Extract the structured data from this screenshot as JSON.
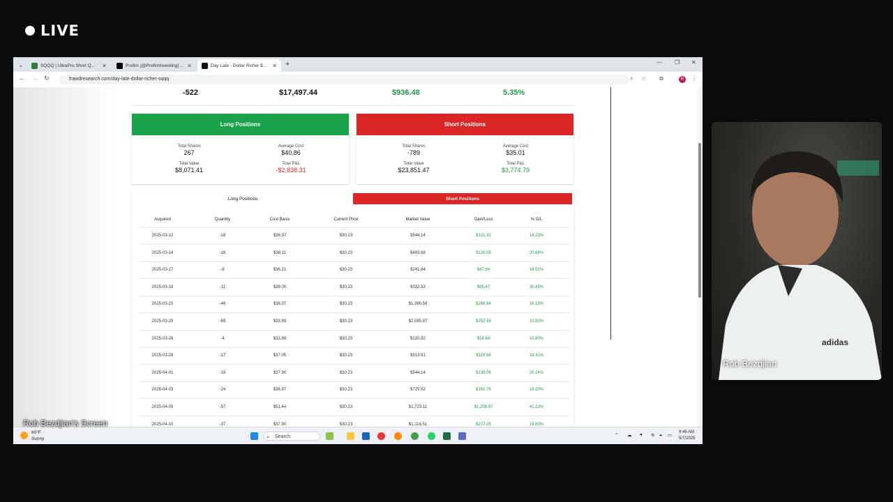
{
  "stream": {
    "live_label": "LIVE",
    "overlay_label": "Rob Bezdjian's Screen"
  },
  "browser": {
    "tabs": [
      {
        "title": "SQQQ | UltraPro Short QQQ | ProShares",
        "active": false
      },
      {
        "title": "Profim (@ProfimInvesting) / X",
        "active": false
      },
      {
        "title": "Day Late - Dollar Richer $SQQQ",
        "active": true
      }
    ],
    "url": "frawdresearch.com/day-late-dollar-richer-sqqq",
    "profile_initial": "R"
  },
  "summary": {
    "quantity": "-522",
    "cost": "$17,497.44",
    "pnl": "$936.48",
    "pct": "5.35%"
  },
  "long_card": {
    "title": "Long Positions",
    "shares_label": "Total Shares",
    "shares": "267",
    "avg_label": "Average Cost",
    "avg": "$40.86",
    "value_label": "Total Value",
    "value": "$8,071.41",
    "pnl_label": "Total P&L",
    "pnl": "-$2,838.31"
  },
  "short_card": {
    "title": "Short Positions",
    "shares_label": "Total Shares",
    "shares": "-789",
    "avg_label": "Average Cost",
    "avg": "$35.01",
    "value_label": "Total Value",
    "value": "$23,851.47",
    "pnl_label": "Total P&L",
    "pnl": "$3,774.79"
  },
  "table": {
    "tabs": [
      "Long Positions",
      "Short Positions"
    ],
    "active_tab": "Short Positions",
    "headers": [
      "Acquired",
      "Quantity",
      "Cost Basis",
      "Current Price",
      "Market Value",
      "Gain/Loss",
      "% G/L"
    ],
    "rows": [
      [
        "2025-03-12",
        "-18",
        "$36.97",
        "$30.23",
        "$544.14",
        "$121.32",
        "18.23%"
      ],
      [
        "2025-03-14",
        "-16",
        "$38.11",
        "$30.23",
        "$483.68",
        "$126.08",
        "20.68%"
      ],
      [
        "2025-03-17",
        "-8",
        "$36.21",
        "$30.23",
        "$241.84",
        "$47.84",
        "16.51%"
      ],
      [
        "2025-03-18",
        "-11",
        "$38.00",
        "$30.23",
        "$332.53",
        "$85.47",
        "20.45%"
      ],
      [
        "2025-03-20",
        "-46",
        "$36.07",
        "$30.23",
        "$1,390.58",
        "$268.64",
        "16.19%"
      ],
      [
        "2025-03-25",
        "-69",
        "$33.89",
        "$30.23",
        "$2,085.87",
        "$252.54",
        "10.80%"
      ],
      [
        "2025-03-26",
        "-4",
        "$33.89",
        "$30.23",
        "$120.92",
        "$14.64",
        "10.80%"
      ],
      [
        "2025-03-28",
        "-17",
        "$37.05",
        "$30.23",
        "$513.91",
        "$115.94",
        "18.41%"
      ],
      [
        "2025-04-01",
        "-18",
        "$37.90",
        "$30.23",
        "$544.14",
        "$138.06",
        "20.24%"
      ],
      [
        "2025-04-03",
        "-24",
        "$36.97",
        "$30.23",
        "$725.52",
        "$161.76",
        "18.23%"
      ],
      [
        "2025-04-09",
        "-57",
        "$51.44",
        "$30.23",
        "$1,723.11",
        "$1,208.97",
        "41.23%"
      ],
      [
        "2025-04-10",
        "-37",
        "$37.90",
        "$30.23",
        "$1,118.51",
        "$272.05",
        "19.60%"
      ]
    ]
  },
  "taskbar": {
    "weather_temp": "60°F",
    "weather_desc": "Sunny",
    "search_placeholder": "Search",
    "time": "9:46 AM",
    "date": "5/7/2025"
  },
  "webcam": {
    "name": "Rob Bezdjian"
  },
  "colors": {
    "long": "#1aa34a",
    "short": "#dc2626",
    "gain": "#1f9d45"
  }
}
